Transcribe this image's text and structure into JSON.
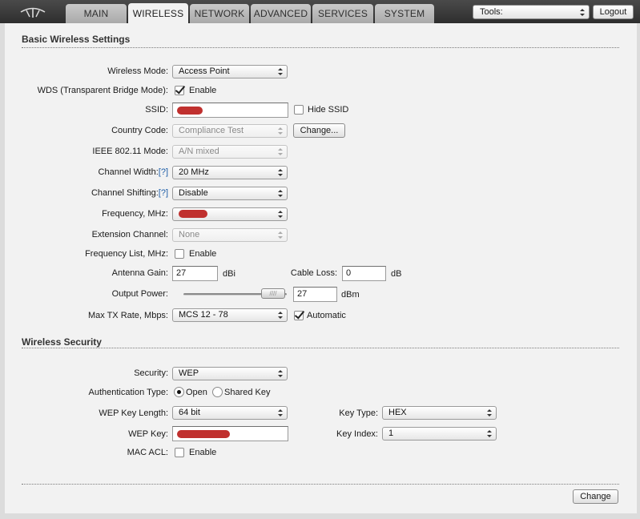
{
  "nav": {
    "tabs": [
      "MAIN",
      "WIRELESS",
      "NETWORK",
      "ADVANCED",
      "SERVICES",
      "SYSTEM"
    ],
    "active_tab": "WIRELESS",
    "tools_label": "Tools:",
    "logout_label": "Logout"
  },
  "basic": {
    "title": "Basic Wireless Settings",
    "wireless_mode_label": "Wireless Mode:",
    "wireless_mode_value": "Access Point",
    "wds_label": "WDS (Transparent Bridge Mode):",
    "wds_enable_label": "Enable",
    "wds_checked": true,
    "ssid_label": "SSID:",
    "hide_ssid_label": "Hide SSID",
    "country_code_label": "Country Code:",
    "country_code_value": "Compliance Test",
    "change_country_label": "Change...",
    "ieee_mode_label": "IEEE 802.11 Mode:",
    "ieee_mode_value": "A/N mixed",
    "channel_width_label": "Channel Width:",
    "channel_width_value": "20 MHz",
    "help_label": "[?]",
    "channel_shifting_label": "Channel Shifting:",
    "channel_shifting_value": "Disable",
    "frequency_label": "Frequency, MHz:",
    "extension_channel_label": "Extension Channel:",
    "extension_channel_value": "None",
    "frequency_list_label": "Frequency List, MHz:",
    "frequency_list_enable_label": "Enable",
    "antenna_gain_label": "Antenna Gain:",
    "antenna_gain_value": "27",
    "antenna_gain_unit": "dBi",
    "cable_loss_label": "Cable Loss:",
    "cable_loss_value": "0",
    "cable_loss_unit": "dB",
    "output_power_label": "Output Power:",
    "output_power_value": "27",
    "output_power_unit": "dBm",
    "output_power_slider_level": 1.0,
    "max_tx_label": "Max TX Rate, Mbps:",
    "max_tx_value": "MCS 12 - 78",
    "automatic_label": "Automatic",
    "automatic_checked": true
  },
  "security": {
    "title": "Wireless Security",
    "security_label": "Security:",
    "security_value": "WEP",
    "auth_type_label": "Authentication Type:",
    "auth_open_label": "Open",
    "auth_shared_label": "Shared Key",
    "auth_selected": "Open",
    "wep_key_length_label": "WEP Key Length:",
    "wep_key_length_value": "64 bit",
    "key_type_label": "Key Type:",
    "key_type_value": "HEX",
    "wep_key_label": "WEP Key:",
    "key_index_label": "Key Index:",
    "key_index_value": "1",
    "mac_acl_label": "MAC ACL:",
    "mac_acl_enable_label": "Enable"
  },
  "footer": {
    "change_button_label": "Change"
  },
  "colors": {
    "redaction": "#c0302e",
    "help_link": "#1f5ea8",
    "topbar": "#3a3a3a",
    "panel": "#f2f2f2"
  }
}
